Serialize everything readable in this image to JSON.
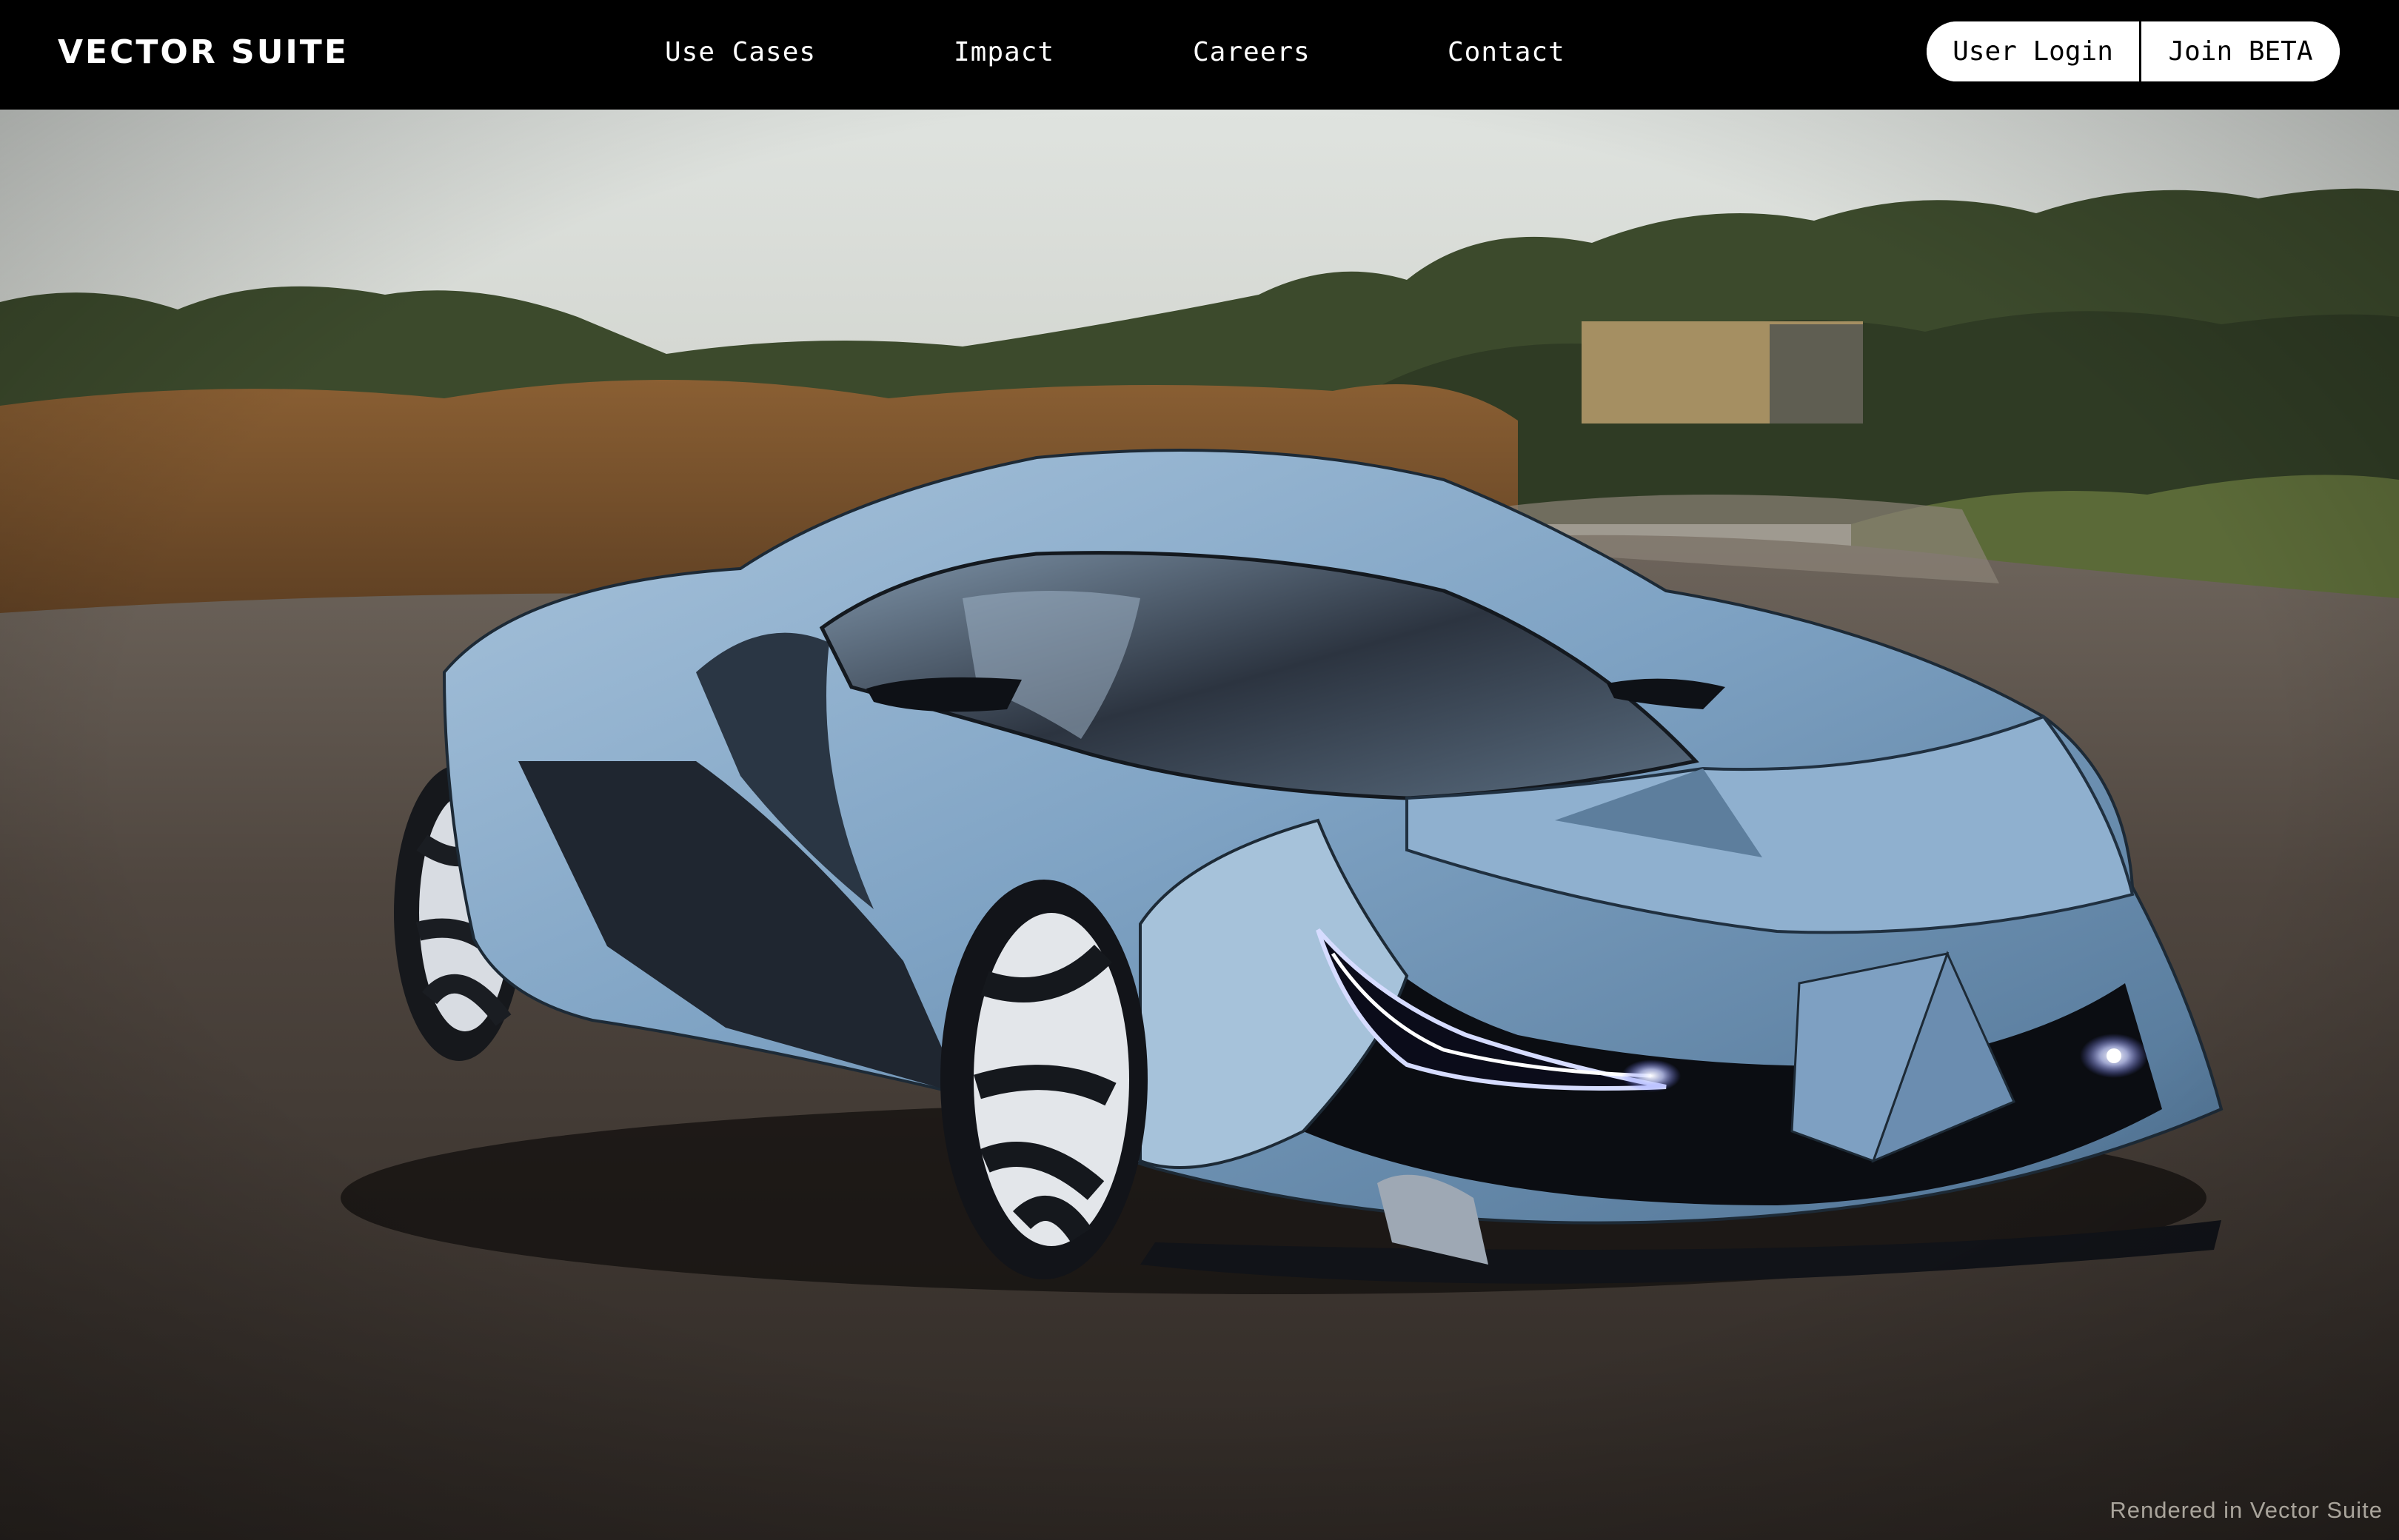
{
  "header": {
    "logo": "VECTOR SUITE",
    "nav": [
      {
        "label": "Use Cases"
      },
      {
        "label": "Impact"
      },
      {
        "label": "Careers"
      },
      {
        "label": "Contact"
      }
    ],
    "login_label": "User Login",
    "beta_label": "Join BETA"
  },
  "hero": {
    "caption": "Rendered in Vector Suite",
    "image_subject": "blue-concept-supercar"
  },
  "colors": {
    "topbar": "#000000",
    "button_bg": "#ffffff",
    "button_text": "#000000",
    "car_body": "#7fa3c4",
    "headlight": "#b9c6ff"
  }
}
